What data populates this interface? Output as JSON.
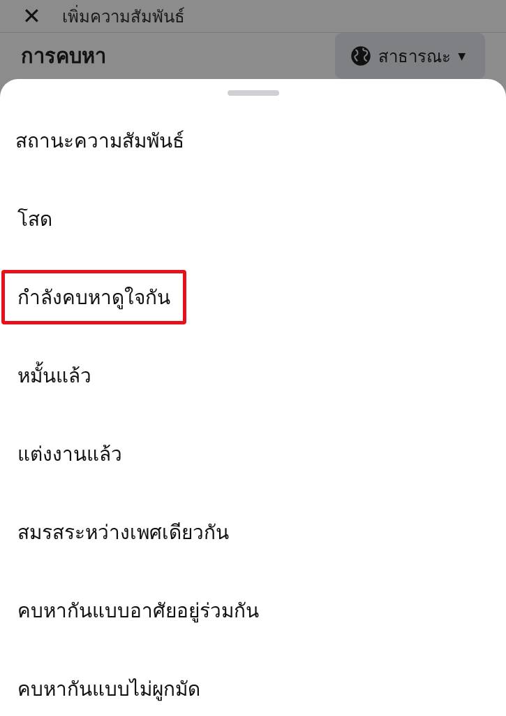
{
  "header": {
    "close": "✕",
    "title": "เพิ่มความสัมพันธ์"
  },
  "section": {
    "title": "การคบหา",
    "privacy": {
      "label": "สาธารณะ",
      "caret": "▼"
    }
  },
  "sheet": {
    "heading": "สถานะความสัมพันธ์",
    "options": [
      {
        "label": "โสด",
        "highlighted": false
      },
      {
        "label": "กำลังคบหาดูใจกัน",
        "highlighted": true
      },
      {
        "label": "หมั้นแล้ว",
        "highlighted": false
      },
      {
        "label": "แต่งงานแล้ว",
        "highlighted": false
      },
      {
        "label": "สมรสระหว่างเพศเดียวกัน",
        "highlighted": false
      },
      {
        "label": "คบหากันแบบอาศัยอยู่ร่วมกัน",
        "highlighted": false
      },
      {
        "label": "คบหากันแบบไม่ผูกมัด",
        "highlighted": false
      }
    ]
  }
}
